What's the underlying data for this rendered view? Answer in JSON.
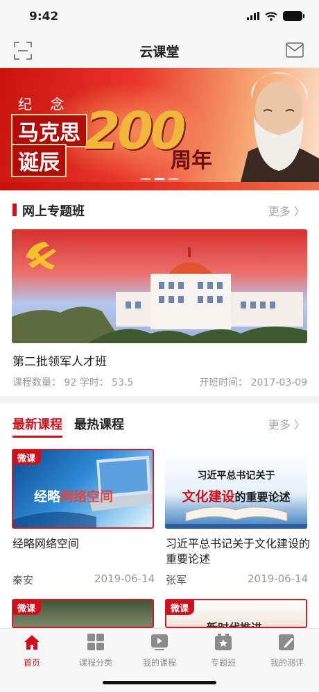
{
  "status_bar": {
    "time": "9:42"
  },
  "header": {
    "title": "云课堂"
  },
  "banner": {
    "line_small": "纪 念",
    "line_1": "马克思",
    "line_2": "诞辰",
    "number": "200",
    "suffix": "周年"
  },
  "special_section": {
    "title": "网上专题班",
    "more": "更多 〉",
    "course": {
      "title": "第二批领军人才班",
      "meta": "课程数量： 92 学时： 53.5",
      "date": "开班时间： 2017-03-09"
    }
  },
  "courses_section": {
    "tabs": [
      "最新课程",
      "最热课程"
    ],
    "more": "更多 〉",
    "badge": "微课",
    "items": [
      {
        "thumb_text_1": "经略",
        "thumb_text_2": "网络空间",
        "title": "经略网络空间",
        "author": "秦安",
        "date": "2019-06-14"
      },
      {
        "thumb_line_1": "习近平总书记关于",
        "thumb_red": "文化建设",
        "thumb_rest": "的重要论述",
        "title": "习近平总书记关于文化建设的重要论述",
        "author": "张军",
        "date": "2019-06-14"
      },
      {
        "thumb_text": ""
      },
      {
        "thumb_text": "新时代推进"
      }
    ]
  },
  "tab_bar": {
    "items": [
      {
        "label": "首页",
        "active": true
      },
      {
        "label": "课程分类",
        "active": false
      },
      {
        "label": "我的课程",
        "active": false
      },
      {
        "label": "专题班",
        "active": false
      },
      {
        "label": "我的测评",
        "active": false
      }
    ],
    "active_color": "#d0111b",
    "inactive_color": "#8b8b8b"
  }
}
